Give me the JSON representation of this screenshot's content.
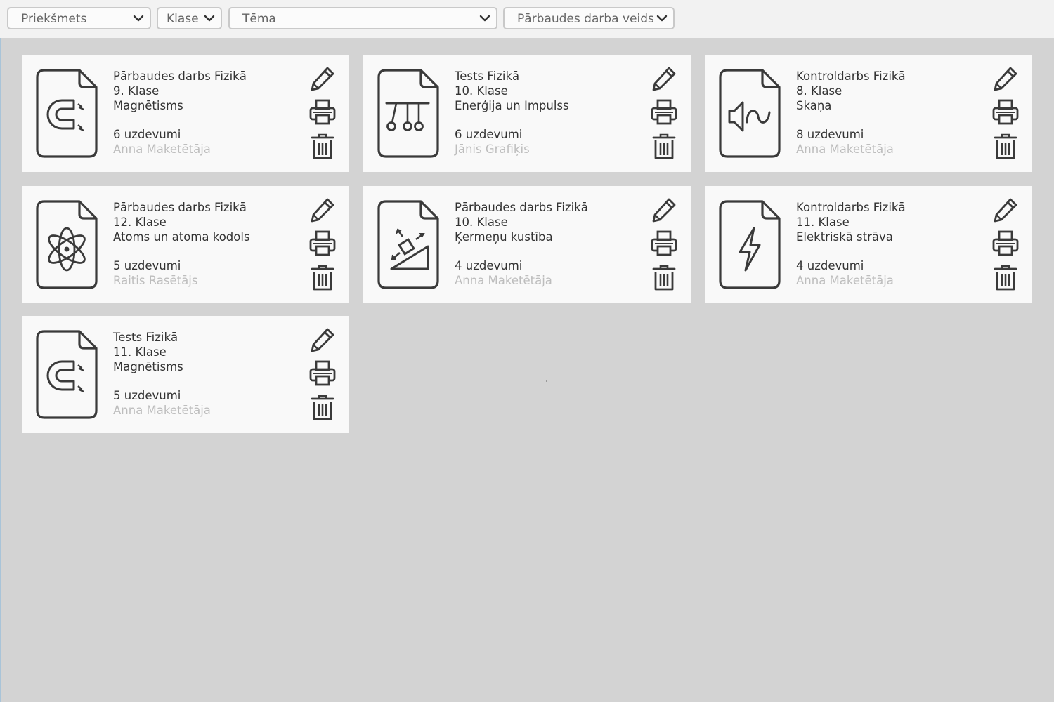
{
  "filters": [
    {
      "label": "Priekšmets"
    },
    {
      "label": "Klase"
    },
    {
      "label": "Tēma"
    },
    {
      "label": "Pārbaudes darba veids"
    }
  ],
  "cards": [
    {
      "type": "Pārbaudes darbs Fizikā",
      "grade": "9. Klase",
      "topic": "Magnētisms",
      "tasks": "6 uzdevumi",
      "author": "Anna Maketētāja",
      "icon": "magnet-icon"
    },
    {
      "type": "Tests Fizikā",
      "grade": "10. Klase",
      "topic": "Enerģija un Impulss",
      "tasks": "6 uzdevumi",
      "author": "Jānis Grafiķis",
      "icon": "newtons-cradle-icon"
    },
    {
      "type": "Kontroldarbs Fizikā",
      "grade": "8. Klase",
      "topic": "Skaņa",
      "tasks": "8 uzdevumi",
      "author": "Anna Maketētāja",
      "icon": "speaker-wave-icon"
    },
    {
      "type": "Pārbaudes darbs Fizikā",
      "grade": "12. Klase",
      "topic": "Atoms un atoma kodols",
      "tasks": "5 uzdevumi",
      "author": "Raitis Rasētājs",
      "icon": "atom-icon"
    },
    {
      "type": "Pārbaudes darbs Fizikā",
      "grade": "10. Klase",
      "topic": "Ķermeņu kustība",
      "tasks": "4 uzdevumi",
      "author": "Anna Maketētāja",
      "icon": "inclined-plane-icon"
    },
    {
      "type": "Kontroldarbs Fizikā",
      "grade": "11. Klase",
      "topic": "Elektriskā strāva",
      "tasks": "4 uzdevumi",
      "author": "Anna Maketētāja",
      "icon": "lightning-icon"
    },
    {
      "type": "Tests Fizikā",
      "grade": "11. Klase",
      "topic": "Magnētisms",
      "tasks": "5 uzdevumi",
      "author": "Anna Maketētāja",
      "icon": "magnet-icon"
    }
  ],
  "colors": {
    "background": "#d3d3d3",
    "filter_bar": "#f2f2f2",
    "card": "#f9f9f9",
    "text": "#333333",
    "author_text": "#bdbdbd",
    "icon_stroke": "#3a3a3a"
  }
}
